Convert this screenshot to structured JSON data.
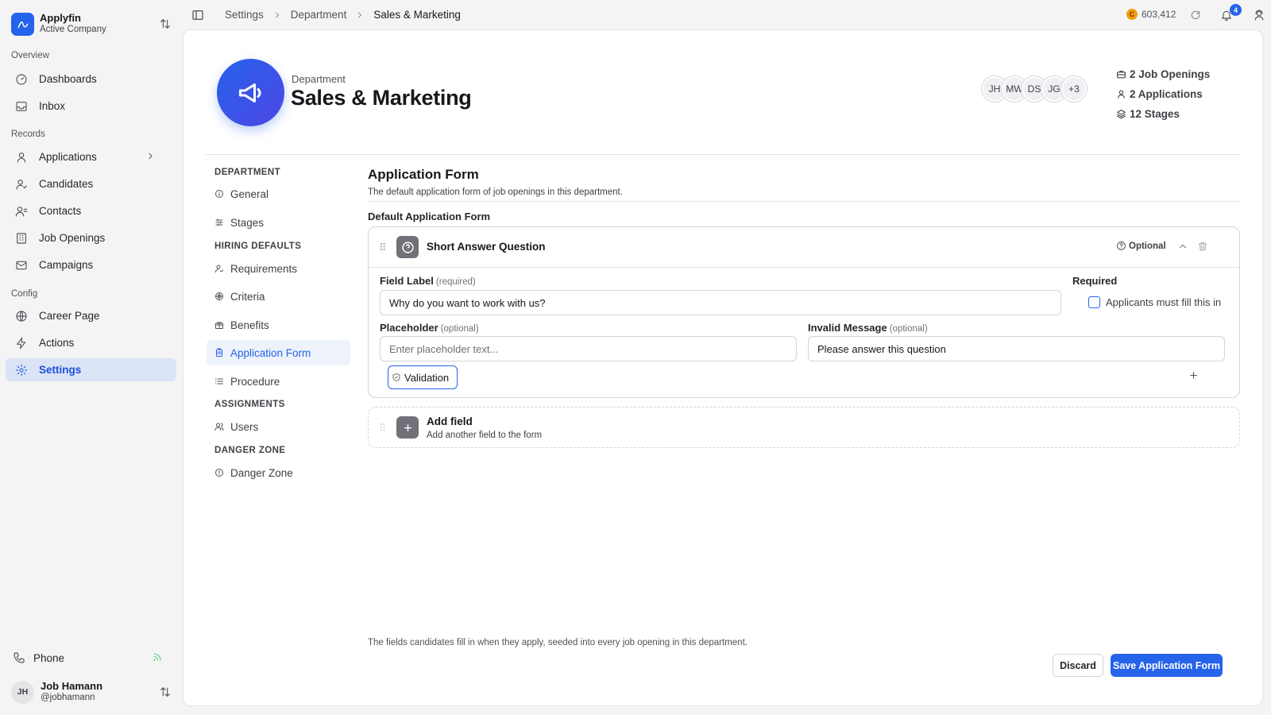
{
  "company": {
    "name": "Applyfin",
    "subtitle": "Active Company"
  },
  "sidebar": {
    "sections": [
      "Overview",
      "Records",
      "Config"
    ],
    "items": [
      {
        "label": "Dashboards",
        "icon": "gauge-icon"
      },
      {
        "label": "Inbox",
        "icon": "inbox-icon"
      },
      {
        "label": "Applications",
        "icon": "person-icon"
      },
      {
        "label": "Candidates",
        "icon": "candidate-icon"
      },
      {
        "label": "Contacts",
        "icon": "contacts-icon"
      },
      {
        "label": "Job Openings",
        "icon": "building-icon"
      },
      {
        "label": "Campaigns",
        "icon": "mail-icon"
      },
      {
        "label": "Career Page",
        "icon": "globe-icon"
      },
      {
        "label": "Actions",
        "icon": "bolt-icon"
      },
      {
        "label": "Settings",
        "icon": "gear-icon",
        "active": true
      }
    ],
    "phone": {
      "label": "Phone"
    },
    "user": {
      "initials": "JH",
      "name": "Job Hamann",
      "handle": "@jobhamann"
    }
  },
  "topbar": {
    "breadcrumb": [
      "Settings",
      "Department",
      "Sales & Marketing"
    ],
    "credits": {
      "coin": "C",
      "value": "603,412"
    },
    "notifications": "4"
  },
  "header": {
    "kicker": "Department",
    "title": "Sales & Marketing",
    "avatars": [
      "JH",
      "MW",
      "DS",
      "JG",
      "+3"
    ],
    "stats": {
      "openings": "2 Job Openings",
      "applications": "2 Applications",
      "stages": "12 Stages"
    }
  },
  "subnav": {
    "department_label": "DEPARTMENT",
    "hiring_label": "HIRING DEFAULTS",
    "assignments_label": "ASSIGNMENTS",
    "danger_label": "DANGER ZONE",
    "items": [
      "General",
      "Stages",
      "Requirements",
      "Criteria",
      "Benefits",
      "Application Form",
      "Procedure",
      "Users",
      "Danger Zone"
    ],
    "active": "Application Form"
  },
  "content": {
    "title": "Application Form",
    "description": "The default application form of job openings in this department.",
    "form_label": "Default Application Form",
    "field": {
      "title": "Short Answer Question",
      "optional_label": "Optional",
      "label_title": "Field Label",
      "label_hint": "(required)",
      "label_value": "Why do you want to work with us?",
      "required_title": "Required",
      "required_text": "Applicants must fill this in",
      "placeholder_title": "Placeholder",
      "placeholder_hint": "(optional)",
      "placeholder_placeholder": "Enter placeholder text...",
      "invalid_title": "Invalid Message",
      "invalid_hint": "(optional)",
      "invalid_value": "Please answer this question",
      "validation_label": "Validation"
    },
    "add_field": {
      "title": "Add field",
      "subtitle": "Add another field to the form"
    },
    "footer_note": "The fields candidates fill in when they apply, seeded into every job opening in this department.",
    "discard_label": "Discard",
    "save_label": "Save Application Form"
  },
  "colors": {
    "accent": "#2563eb",
    "active_nav_bg": "#dbe4f7",
    "coin": "#f59e0b",
    "online": "#22c55e"
  }
}
